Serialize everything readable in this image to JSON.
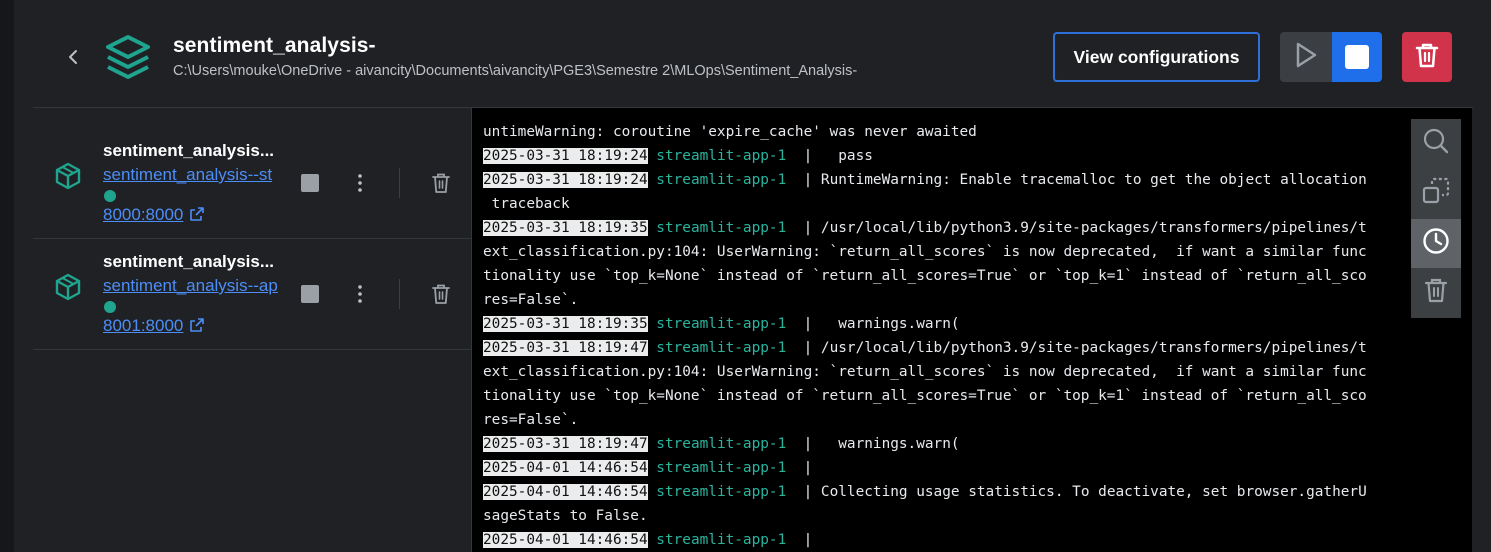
{
  "header": {
    "title": "sentiment_analysis-",
    "path": "C:\\Users\\mouke\\OneDrive - aivancity\\Documents\\aivancity\\PGE3\\Semestre 2\\MLOps\\Sentiment_Analysis-",
    "view_configurations_label": "View configurations"
  },
  "containers": [
    {
      "name": "sentiment_analysis...",
      "image_link": "sentiment_analysis--st",
      "status": "running",
      "port": "8000:8000"
    },
    {
      "name": "sentiment_analysis...",
      "image_link": "sentiment_analysis--ap",
      "status": "running",
      "port": "8001:8000"
    }
  ],
  "logs": [
    {
      "ts": "",
      "svc": "",
      "msg": "untimeWarning: coroutine 'expire_cache' was never awaited"
    },
    {
      "ts": "2025-03-31 18:19:24",
      "svc": "streamlit-app-1",
      "msg": "  |   pass"
    },
    {
      "ts": "2025-03-31 18:19:24",
      "svc": "streamlit-app-1",
      "msg": "  | RuntimeWarning: Enable tracemalloc to get the object allocation"
    },
    {
      "ts": "",
      "svc": "",
      "msg": " traceback"
    },
    {
      "ts": "2025-03-31 18:19:35",
      "svc": "streamlit-app-1",
      "msg": "  | /usr/local/lib/python3.9/site-packages/transformers/pipelines/t"
    },
    {
      "ts": "",
      "svc": "",
      "msg": "ext_classification.py:104: UserWarning: `return_all_scores` is now deprecated,  if want a similar func"
    },
    {
      "ts": "",
      "svc": "",
      "msg": "tionality use `top_k=None` instead of `return_all_scores=True` or `top_k=1` instead of `return_all_sco"
    },
    {
      "ts": "",
      "svc": "",
      "msg": "res=False`."
    },
    {
      "ts": "2025-03-31 18:19:35",
      "svc": "streamlit-app-1",
      "msg": "  |   warnings.warn("
    },
    {
      "ts": "2025-03-31 18:19:47",
      "svc": "streamlit-app-1",
      "msg": "  | /usr/local/lib/python3.9/site-packages/transformers/pipelines/t"
    },
    {
      "ts": "",
      "svc": "",
      "msg": "ext_classification.py:104: UserWarning: `return_all_scores` is now deprecated,  if want a similar func"
    },
    {
      "ts": "",
      "svc": "",
      "msg": "tionality use `top_k=None` instead of `return_all_scores=True` or `top_k=1` instead of `return_all_sco"
    },
    {
      "ts": "",
      "svc": "",
      "msg": "res=False`."
    },
    {
      "ts": "2025-03-31 18:19:47",
      "svc": "streamlit-app-1",
      "msg": "  |   warnings.warn("
    },
    {
      "ts": "2025-04-01 14:46:54",
      "svc": "streamlit-app-1",
      "msg": "  |"
    },
    {
      "ts": "2025-04-01 14:46:54",
      "svc": "streamlit-app-1",
      "msg": "  | Collecting usage statistics. To deactivate, set browser.gatherU"
    },
    {
      "ts": "",
      "svc": "",
      "msg": "sageStats to False."
    },
    {
      "ts": "2025-04-01 14:46:54",
      "svc": "streamlit-app-1",
      "msg": "  |"
    }
  ],
  "log_tools": [
    {
      "icon": "search-icon",
      "active": false
    },
    {
      "icon": "copy-icon",
      "active": false
    },
    {
      "icon": "clock-icon",
      "active": true
    },
    {
      "icon": "trash-icon",
      "active": false
    }
  ],
  "colors": {
    "accent": "#1f6feb",
    "link": "#4c8ef7",
    "running": "#1fa58f",
    "service": "#2bb39c",
    "danger": "#d1344a"
  }
}
